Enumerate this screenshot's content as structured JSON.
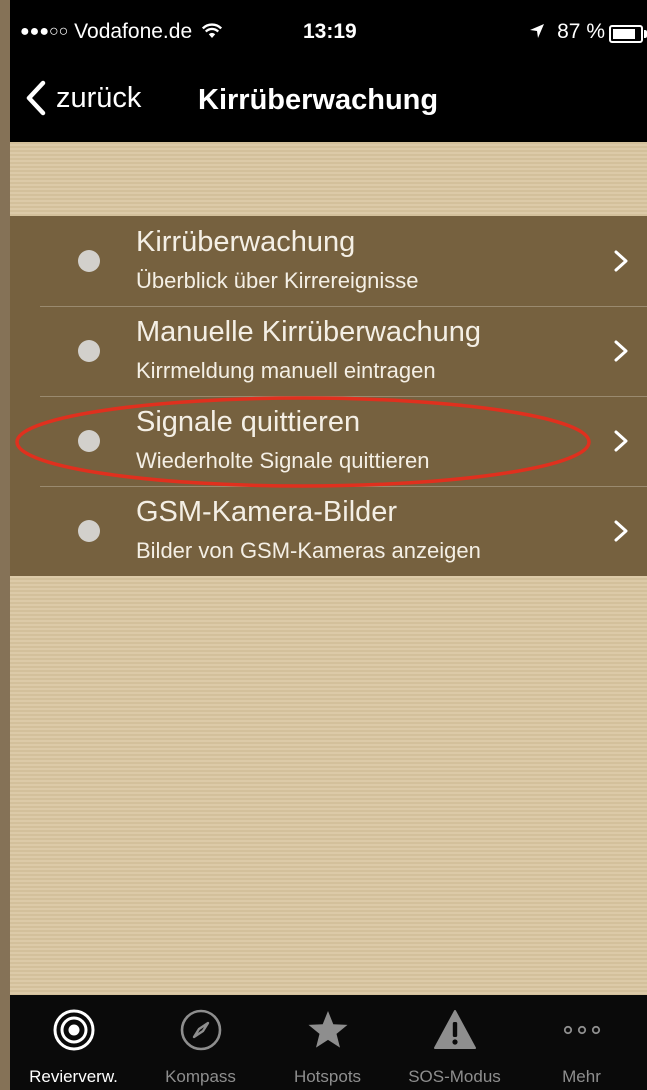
{
  "status_bar": {
    "signal": "●●●○○",
    "carrier": "Vodafone.de",
    "time": "13:19",
    "battery": "87 %"
  },
  "nav": {
    "back_label": "zurück",
    "title": "Kirrüberwachung"
  },
  "menu": [
    {
      "title": "Kirrüberwachung",
      "subtitle": "Überblick über Kirrereignisse"
    },
    {
      "title": "Manuelle Kirrüberwachung",
      "subtitle": "Kirrmeldung manuell eintragen"
    },
    {
      "title": "Signale quittieren",
      "subtitle": "Wiederholte Signale quittieren"
    },
    {
      "title": "GSM-Kamera-Bilder",
      "subtitle": "Bilder von GSM-Kameras anzeigen"
    }
  ],
  "tabs": [
    {
      "label": "Revierverw.",
      "icon": "target-icon",
      "active": true
    },
    {
      "label": "Kompass",
      "icon": "compass-icon"
    },
    {
      "label": "Hotspots",
      "icon": "star-icon"
    },
    {
      "label": "SOS-Modus",
      "icon": "warning-icon"
    },
    {
      "label": "Mehr",
      "icon": "more-icon"
    }
  ],
  "colors": {
    "menu_background": "#76613f",
    "page_background": "#dccaa8",
    "highlight_ellipse": "#e0301e"
  }
}
